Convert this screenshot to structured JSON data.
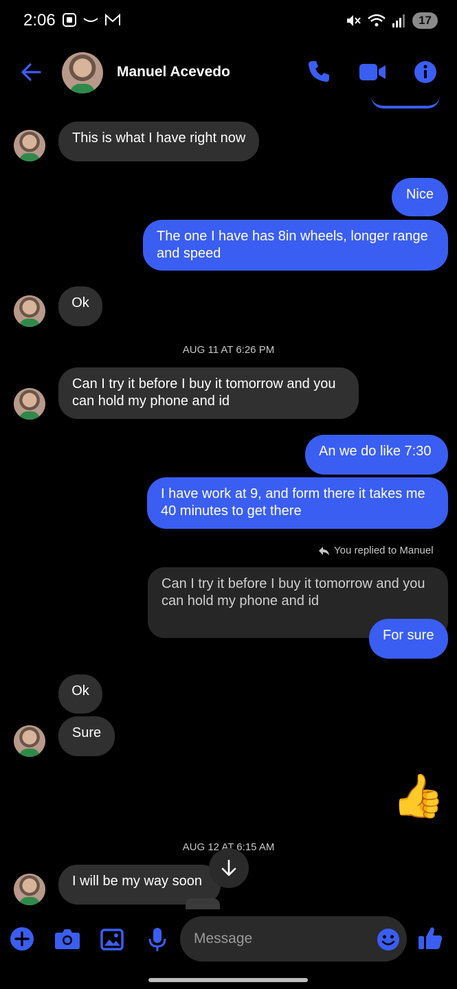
{
  "status_bar": {
    "time": "2:06",
    "battery": "17"
  },
  "header": {
    "contact_name": "Manuel Acevedo"
  },
  "messages": {
    "m1": "This is what I have right now",
    "m2": "Nice",
    "m3": "The one I have has 8in wheels, longer range and speed",
    "m4": "Ok",
    "stamp1": "AUG 11 AT 6:26 PM",
    "m5": "Can I try it before I buy it tomorrow and you can hold my phone and id",
    "m6": "An we do like 7:30",
    "m7": "I have work at 9, and form there it takes me 40 minutes to get there",
    "reply_note": "You replied to Manuel",
    "quoted": "Can I try it before I buy it tomorrow and you can hold my phone and id",
    "m8": "For sure",
    "m9": "Ok",
    "m10": "Sure",
    "m11": "👍",
    "stamp2": "AUG 12 AT 6:15 AM",
    "m12": "I will be my way soon"
  },
  "composer": {
    "placeholder": "Message"
  },
  "colors": {
    "accent": "#3a5ef2",
    "incoming": "#303030",
    "background": "#000000"
  }
}
